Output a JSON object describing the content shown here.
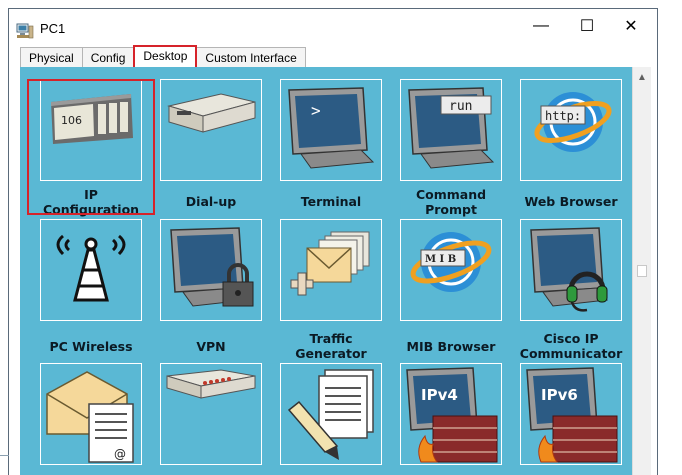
{
  "window": {
    "title": "PC1",
    "minimize_glyph": "—",
    "maximize_glyph": "☐",
    "close_glyph": "✕",
    "app_icon": "pc-icon"
  },
  "tabs": [
    {
      "label": "Physical"
    },
    {
      "label": "Config"
    },
    {
      "label": "Desktop",
      "active": true
    },
    {
      "label": "Custom Interface"
    }
  ],
  "desktop": {
    "selected_item": "IP Configuration",
    "items": [
      {
        "line1": "IP",
        "line2": "Configuration",
        "icon": "ip-configuration-icon",
        "icon_text": "106"
      },
      {
        "line1": "Dial-up",
        "line2": "",
        "icon": "modem-icon"
      },
      {
        "line1": "Terminal",
        "line2": "",
        "icon": "terminal-icon",
        "icon_text": ">"
      },
      {
        "line1": "Command",
        "line2": "Prompt",
        "icon": "command-prompt-icon",
        "icon_text": "run"
      },
      {
        "line1": "Web Browser",
        "line2": "",
        "icon": "web-browser-icon",
        "icon_text": "http:"
      },
      {
        "line1": "PC Wireless",
        "line2": "",
        "icon": "wireless-tower-icon"
      },
      {
        "line1": "VPN",
        "line2": "",
        "icon": "vpn-lock-icon"
      },
      {
        "line1": "Traffic",
        "line2": "Generator",
        "icon": "traffic-generator-icon"
      },
      {
        "line1": "MIB Browser",
        "line2": "",
        "icon": "mib-browser-icon",
        "icon_text": "M I B"
      },
      {
        "line1": "Cisco IP",
        "line2": "Communicator",
        "icon": "headset-icon"
      },
      {
        "line1": "",
        "line2": "",
        "icon": "email-icon",
        "icon_text": "@"
      },
      {
        "line1": "",
        "line2": "",
        "icon": "pppoe-dialer-icon"
      },
      {
        "line1": "",
        "line2": "",
        "icon": "text-editor-icon"
      },
      {
        "line1": "",
        "line2": "",
        "icon": "ipv4-firewall-icon",
        "icon_text": "IPv4"
      },
      {
        "line1": "",
        "line2": "",
        "icon": "ipv6-firewall-icon",
        "icon_text": "IPv6"
      }
    ]
  },
  "colors": {
    "desktop_bg": "#5ab8d4",
    "selection": "#d6232a",
    "tile_border": "#ffffff"
  }
}
